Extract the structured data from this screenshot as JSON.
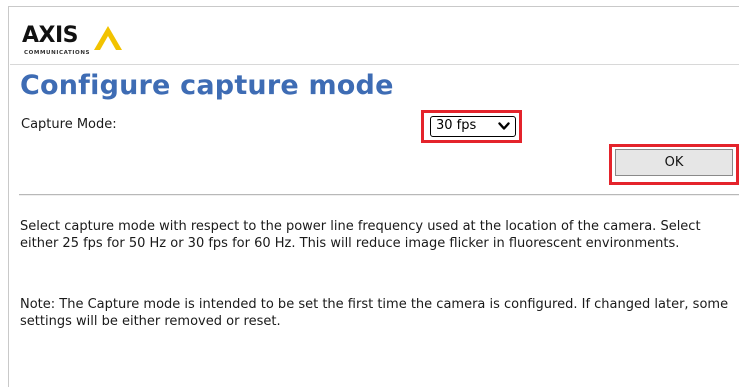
{
  "brand": {
    "logo_word": "AXIS",
    "logo_sub": "COMMUNICATIONS"
  },
  "page": {
    "title": "Configure capture mode"
  },
  "form": {
    "capture_mode_label": "Capture Mode:",
    "capture_mode_value": "30 fps",
    "ok_label": "OK"
  },
  "info": {
    "description": "Select capture mode with respect to the power line frequency used at the location of the camera. Select either 25 fps for 50 Hz or 30 fps for 60 Hz. This will reduce image flicker in fluorescent environments.",
    "note": "Note: The Capture mode is intended to be set the first time the camera is configured. If changed later, some settings will be either removed or reset."
  },
  "colors": {
    "title": "#3e6cb4",
    "highlight": "#e4232b",
    "logo_triangle": "#f2c300"
  }
}
